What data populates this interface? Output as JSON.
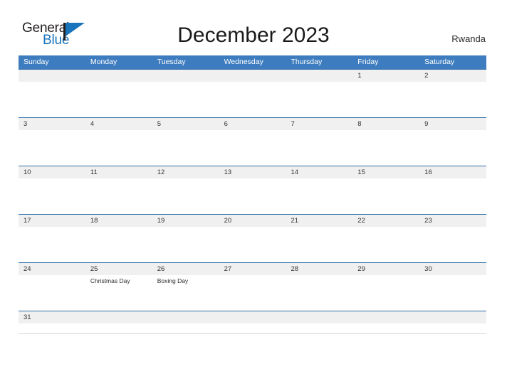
{
  "brand": {
    "name_part1": "General",
    "name_part2": "Blue",
    "flag_icon": "flag-triangle-icon",
    "colors": {
      "dark": "#231f20",
      "blue": "#1a74bb"
    }
  },
  "header": {
    "title": "December 2023",
    "country": "Rwanda"
  },
  "calendar": {
    "header_bg": "#3d7cbe",
    "row_line": "#2f6da8",
    "date_band_bg": "#f0f0f0",
    "weekdays": [
      "Sunday",
      "Monday",
      "Tuesday",
      "Wednesday",
      "Thursday",
      "Friday",
      "Saturday"
    ],
    "weeks": [
      {
        "days": [
          {
            "date": "",
            "event": ""
          },
          {
            "date": "",
            "event": ""
          },
          {
            "date": "",
            "event": ""
          },
          {
            "date": "",
            "event": ""
          },
          {
            "date": "",
            "event": ""
          },
          {
            "date": "1",
            "event": ""
          },
          {
            "date": "2",
            "event": ""
          }
        ]
      },
      {
        "days": [
          {
            "date": "3",
            "event": ""
          },
          {
            "date": "4",
            "event": ""
          },
          {
            "date": "5",
            "event": ""
          },
          {
            "date": "6",
            "event": ""
          },
          {
            "date": "7",
            "event": ""
          },
          {
            "date": "8",
            "event": ""
          },
          {
            "date": "9",
            "event": ""
          }
        ]
      },
      {
        "days": [
          {
            "date": "10",
            "event": ""
          },
          {
            "date": "11",
            "event": ""
          },
          {
            "date": "12",
            "event": ""
          },
          {
            "date": "13",
            "event": ""
          },
          {
            "date": "14",
            "event": ""
          },
          {
            "date": "15",
            "event": ""
          },
          {
            "date": "16",
            "event": ""
          }
        ]
      },
      {
        "days": [
          {
            "date": "17",
            "event": ""
          },
          {
            "date": "18",
            "event": ""
          },
          {
            "date": "19",
            "event": ""
          },
          {
            "date": "20",
            "event": ""
          },
          {
            "date": "21",
            "event": ""
          },
          {
            "date": "22",
            "event": ""
          },
          {
            "date": "23",
            "event": ""
          }
        ]
      },
      {
        "days": [
          {
            "date": "24",
            "event": ""
          },
          {
            "date": "25",
            "event": "Christmas Day"
          },
          {
            "date": "26",
            "event": "Boxing Day"
          },
          {
            "date": "27",
            "event": ""
          },
          {
            "date": "28",
            "event": ""
          },
          {
            "date": "29",
            "event": ""
          },
          {
            "date": "30",
            "event": ""
          }
        ]
      },
      {
        "days": [
          {
            "date": "31",
            "event": ""
          },
          {
            "date": "",
            "event": ""
          },
          {
            "date": "",
            "event": ""
          },
          {
            "date": "",
            "event": ""
          },
          {
            "date": "",
            "event": ""
          },
          {
            "date": "",
            "event": ""
          },
          {
            "date": "",
            "event": ""
          }
        ]
      }
    ]
  }
}
